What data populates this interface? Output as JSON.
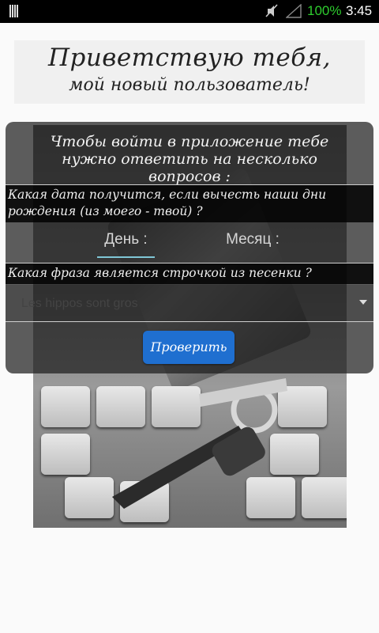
{
  "status_bar": {
    "battery": "100%",
    "time": "3:45",
    "icons": [
      "barcode-icon",
      "mute-icon",
      "signal-icon"
    ]
  },
  "greeting": {
    "line1": "Приветствую тебя,",
    "line2": "мой новый пользователь!"
  },
  "dialog": {
    "title": "Чтобы войти в приложение тебе нужно ответить на несколько вопросов :",
    "question1": "Какая дата получится, если вычесть наши дни рождения (из моего - твой) ?",
    "day_placeholder": "День :",
    "month_placeholder": "Месяц :",
    "question2": "Какая фраза является строчкой из песенки ?",
    "spinner_value": "Les hippos sont gros",
    "check_button": "Проверить"
  },
  "colors": {
    "button": "#1f6fd0",
    "battery": "#2ecc2e",
    "field_underline": "#7fc6d6"
  }
}
